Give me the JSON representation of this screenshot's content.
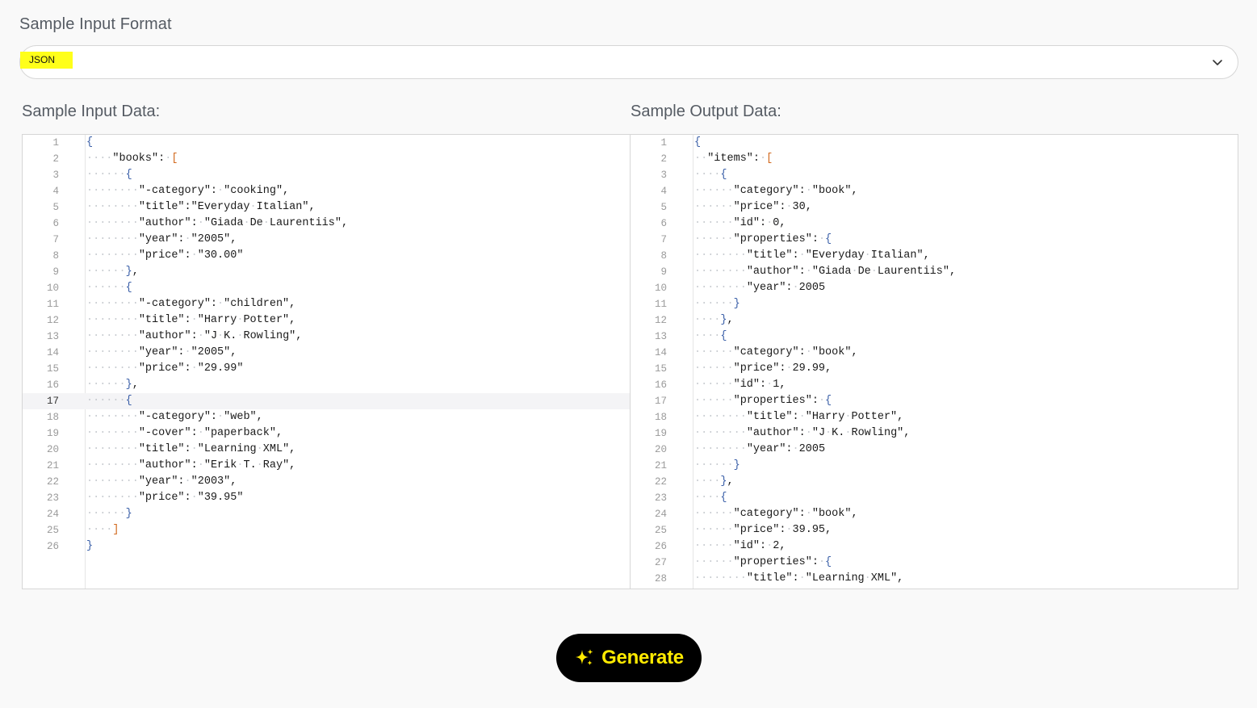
{
  "format": {
    "label": "Sample Input Format",
    "selected": "JSON"
  },
  "input_panel": {
    "label": "Sample Input Data:",
    "active_line": 17,
    "lines": [
      "{",
      "····\"books\":·[",
      "······{",
      "········\"-category\":·\"cooking\",",
      "········\"title\":\"Everyday·Italian\",",
      "········\"author\":·\"Giada·De·Laurentiis\",",
      "········\"year\":·\"2005\",",
      "········\"price\":·\"30.00\"",
      "······},",
      "······{",
      "········\"-category\":·\"children\",",
      "········\"title\":·\"Harry·Potter\",",
      "········\"author\":·\"J·K.·Rowling\",",
      "········\"year\":·\"2005\",",
      "········\"price\":·\"29.99\"",
      "······},",
      "······{",
      "········\"-category\":·\"web\",",
      "········\"-cover\":·\"paperback\",",
      "········\"title\":·\"Learning·XML\",",
      "········\"author\":·\"Erik·T.·Ray\",",
      "········\"year\":·\"2003\",",
      "········\"price\":·\"39.95\"",
      "······}",
      "····]",
      "}"
    ]
  },
  "output_panel": {
    "label": "Sample Output Data:",
    "lines": [
      "{",
      "··\"items\":·[",
      "····{",
      "······\"category\":·\"book\",",
      "······\"price\":·30,",
      "······\"id\":·0,",
      "······\"properties\":·{",
      "········\"title\":·\"Everyday·Italian\",",
      "········\"author\":·\"Giada·De·Laurentiis\",",
      "········\"year\":·2005",
      "······}",
      "····},",
      "····{",
      "······\"category\":·\"book\",",
      "······\"price\":·29.99,",
      "······\"id\":·1,",
      "······\"properties\":·{",
      "········\"title\":·\"Harry·Potter\",",
      "········\"author\":·\"J·K.·Rowling\",",
      "········\"year\":·2005",
      "······}",
      "····},",
      "····{",
      "······\"category\":·\"book\",",
      "······\"price\":·39.95,",
      "······\"id\":·2,",
      "······\"properties\":·{",
      "········\"title\":·\"Learning·XML\","
    ]
  },
  "generate": {
    "label": "Generate",
    "icon": "sparkle-icon",
    "color": "#ffea00"
  }
}
